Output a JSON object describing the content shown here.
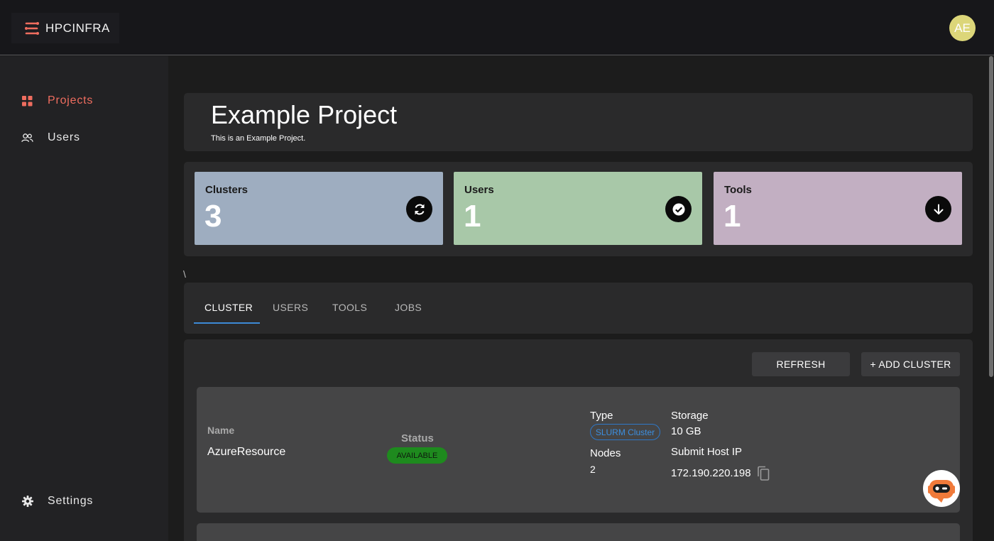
{
  "app": {
    "name": "HPCINFRA",
    "user_initials": "AE",
    "brand_color": "#ef6d5f"
  },
  "sidebar": {
    "items": [
      {
        "label": "Projects",
        "icon": "grid-icon",
        "active": true
      },
      {
        "label": "Users",
        "icon": "users-icon",
        "active": false
      }
    ],
    "settings_label": "Settings"
  },
  "project": {
    "title": "Example Project",
    "description": "This is an Example Project."
  },
  "stats": [
    {
      "label": "Clusters",
      "value": "3",
      "color": "#9eadc0",
      "icon": "refresh-icon"
    },
    {
      "label": "Users",
      "value": "1",
      "color": "#a8c8a8",
      "icon": "check-circle-icon"
    },
    {
      "label": "Tools",
      "value": "1",
      "color": "#c2afc2",
      "icon": "arrow-down-icon"
    }
  ],
  "stray_text": "\\",
  "tabs": [
    {
      "label": "CLUSTER",
      "active": true
    },
    {
      "label": "USERS",
      "active": false
    },
    {
      "label": "TOOLS",
      "active": false
    },
    {
      "label": "JOBS",
      "active": false
    }
  ],
  "actions": {
    "refresh_label": "REFRESH",
    "add_cluster_label": "+ ADD CLUSTER"
  },
  "cluster": {
    "name_label": "Name",
    "name": "AzureResource",
    "status_label": "Status",
    "status": "AVAILABLE",
    "type_label": "Type",
    "type": "SLURM Cluster",
    "nodes_label": "Nodes",
    "nodes": "2",
    "storage_label": "Storage",
    "storage": "10 GB",
    "submit_host_label": "Submit Host IP",
    "submit_host_ip": "172.190.220.198"
  }
}
